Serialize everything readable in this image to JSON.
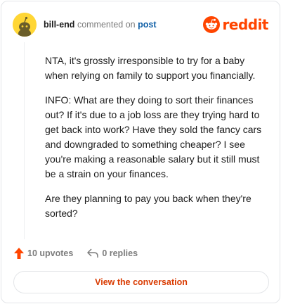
{
  "header": {
    "username": "bill-end",
    "action_text": "commented on",
    "post_link": "post",
    "brand_name": "reddit"
  },
  "comment": {
    "paragraphs": [
      "NTA, it's grossly irresponsible to try for a baby when relying on family to support you financially.",
      "INFO: What are they doing to sort their finances out? If it's due to a job loss are they trying hard to get back into work? Have they sold the fancy cars and downgraded to something cheaper? I see you're making a reasonable salary but it still must be a strain on your finances.",
      "Are they planning to pay you back when they're sorted?"
    ]
  },
  "footer": {
    "upvotes_label": "10 upvotes",
    "replies_label": "0 replies",
    "cta_label": "View the conversation"
  },
  "colors": {
    "brand": "#ff4500",
    "upvote": "#ff4500",
    "cta_text": "#d93a00",
    "link": "#0f5fa6",
    "avatar_bg": "#ffd635"
  },
  "icons": {
    "avatar": "snoo-avatar-icon",
    "brand": "reddit-logo-icon",
    "upvote": "upvote-arrow-icon",
    "reply": "reply-arrow-icon"
  }
}
